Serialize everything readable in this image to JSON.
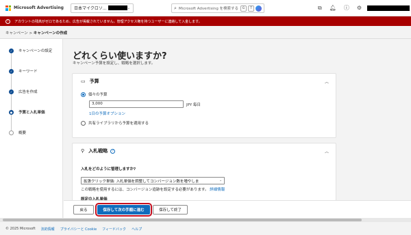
{
  "topbar": {
    "brand": "Microsoft Advertising",
    "account_name": "日本マイクロソ...",
    "search_placeholder": "Microsoft Advertising を検索する",
    "kbd_keys": [
      "G",
      "T"
    ]
  },
  "banner": {
    "text": "アカウントの残高がゼロであるため、広告が掲載されていません。管理アクセス権を持つユーザーに連絡して入金します。"
  },
  "breadcrumb": {
    "parent": "キャンペーン",
    "separator": " > ",
    "current": "キャンペーンの作成"
  },
  "steps": [
    {
      "label": "キャンペーンの設定",
      "state": "done"
    },
    {
      "label": "キーワード",
      "state": "done"
    },
    {
      "label": "広告を作成",
      "state": "done"
    },
    {
      "label": "予算と入札単価",
      "state": "current"
    },
    {
      "label": "概要",
      "state": "pending"
    }
  ],
  "main": {
    "title": "どれくらい使いますか?",
    "subtitle": "キャンペーン予算を設定し、戦略を選択します。"
  },
  "budget_card": {
    "title": "予算",
    "option_individual": "個々の予算",
    "amount_value": "3,000",
    "amount_unit": "JPY 毎日",
    "daily_option_link": "1日の予算オプション",
    "option_shared": "共有ライブラリから予算を適用する"
  },
  "bid_card": {
    "title": "入札戦略",
    "question": "入札をどのように管理しますか?",
    "strategy_value": "拡張クリック単価: 入札単価を調整してコンバージョン数を増やしま",
    "note_text": "この戦略を使用するには、コンバージョン追跡を設定する必要があります。",
    "note_link": "詳細情報",
    "cut_label": "既定の入札単価"
  },
  "actions": {
    "back": "戻る",
    "save_next": "保存して次の手順に進む",
    "save_exit": "保存して終了"
  },
  "footer": {
    "copyright": "© 2025 Microsoft",
    "links": [
      "法的情報",
      "プライバシーと Cookie",
      "フィードバック",
      "ヘルプ"
    ]
  },
  "colors": {
    "banner": "#a80000",
    "primary": "#0f6cbd",
    "highlight_outline": "#c50f1f"
  }
}
